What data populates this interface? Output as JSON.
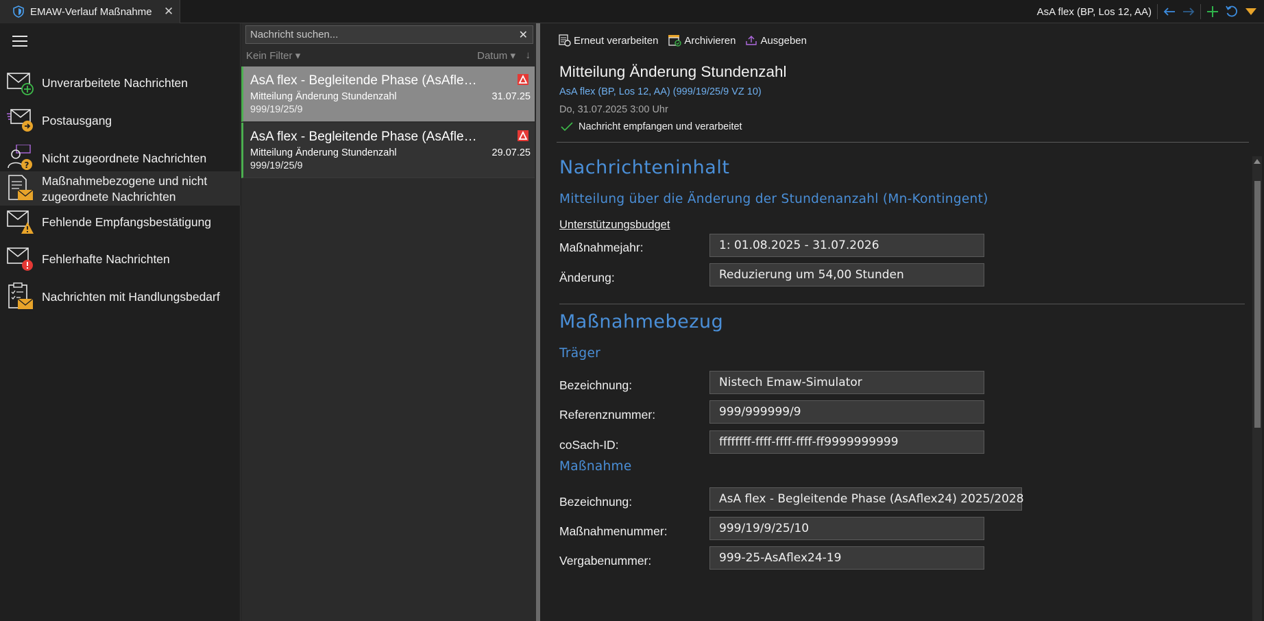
{
  "tab": {
    "title": "EMAW-Verlauf Maßnahme",
    "close": "✕"
  },
  "header": {
    "context": "AsA flex (BP, Los 12, AA)"
  },
  "toolbar": {
    "icons": [
      "arrow-left-icon",
      "arrow-right-icon",
      "plus-icon",
      "refresh-icon",
      "triangle-down-icon"
    ]
  },
  "nav": {
    "items": [
      {
        "label": "Unverarbeitete Nachrichten",
        "icon": "mail-plus-icon"
      },
      {
        "label": "Postausgang",
        "icon": "mail-outbox-icon"
      },
      {
        "label": "Nicht zugeordnete Nachrichten",
        "icon": "person-question-icon"
      },
      {
        "label": "Maßnahmebezogene und nicht zugeordnete Nachrichten",
        "line1": "Maßnahmebezogene und nicht",
        "line2": "zugeordnete Nachrichten",
        "icon": "document-mail-icon",
        "active": true
      },
      {
        "label": "Fehlende Empfangsbestätigung",
        "icon": "mail-warning-icon"
      },
      {
        "label": "Fehlerhafte Nachrichten",
        "icon": "mail-error-icon"
      },
      {
        "label": "Nachrichten mit Handlungsbedarf",
        "icon": "clipboard-mail-icon"
      }
    ]
  },
  "messages": {
    "search_placeholder": "Nachricht suchen...",
    "filter_label": "Kein Filter",
    "sort_label": "Datum",
    "list": [
      {
        "title": "AsA flex - Begleitende Phase (AsAflex24) 2025/2028",
        "subject": "Mitteilung Änderung Stundenzahl",
        "date": "31.07.25",
        "ref": "999/19/25/9",
        "selected": true
      },
      {
        "title": "AsA flex - Begleitende Phase (AsAflex24) 2025/2028",
        "subject": "Mitteilung Änderung Stundenzahl",
        "date": "29.07.25",
        "ref": "999/19/25/9",
        "selected": false
      }
    ]
  },
  "detail": {
    "actions": [
      {
        "label": "Erneut verarbeiten",
        "icon": "gear-doc-icon"
      },
      {
        "label": "Archivieren",
        "icon": "archive-icon"
      },
      {
        "label": "Ausgeben",
        "icon": "export-icon"
      }
    ],
    "title": "Mitteilung Änderung Stundenzahl",
    "link": "AsA flex (BP, Los 12, AA) (999/19/25/9 VZ 10)",
    "date": "Do, 31.07.2025 3:00 Uhr",
    "status": "Nachricht empfangen und verarbeitet",
    "content": {
      "section1": {
        "heading": "Nachrichteninhalt",
        "subheading": "Mitteilung über die Änderung der Stundenanzahl (Mn-Kontingent)",
        "group": "Unterstützungsbudget",
        "fields": [
          {
            "label": "Maßnahmejahr:",
            "value": "1: 01.08.2025 - 31.07.2026"
          },
          {
            "label": "Änderung:",
            "value": "Reduzierung um 54,00 Stunden"
          }
        ]
      },
      "section2": {
        "heading": "Maßnahmebezug",
        "traeger": {
          "subheading": "Träger",
          "fields": [
            {
              "label": "Bezeichnung:",
              "value": "Nistech Emaw-Simulator"
            },
            {
              "label": "Referenznummer:",
              "value": "999/999999/9"
            },
            {
              "label": "coSach-ID:",
              "value": "ffffffff-ffff-ffff-ffff-ff9999999999"
            }
          ]
        },
        "massnahme": {
          "subheading": "Maßnahme",
          "fields": [
            {
              "label": "Bezeichnung:",
              "value": "AsA flex - Begleitende Phase (AsAflex24) 2025/2028"
            },
            {
              "label": "Maßnahmenummer:",
              "value": "999/19/9/25/10"
            },
            {
              "label": "Vergabenummer:",
              "value": "999-25-AsAflex24-19"
            }
          ]
        }
      }
    }
  },
  "colors": {
    "accent_blue": "#4a8fd8",
    "link_blue": "#6fb0f0",
    "success_green": "#4caf50",
    "alert_red": "#e53935"
  }
}
